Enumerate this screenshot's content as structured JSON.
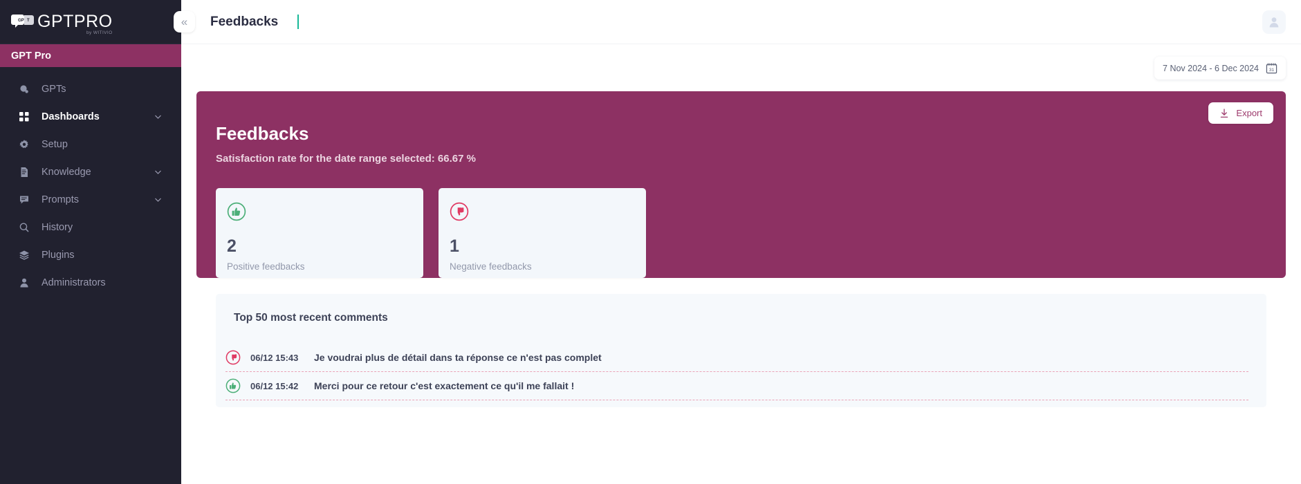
{
  "brand": {
    "logo_text": "GPTPRO",
    "logo_sub": "by WITIVIO",
    "workspace": "GPT Pro"
  },
  "sidebar": {
    "collapse_label": "«",
    "items": [
      {
        "label": "GPTs",
        "icon": "gpts-icon",
        "active": false,
        "chevron": false
      },
      {
        "label": "Dashboards",
        "icon": "dashboard-icon",
        "active": true,
        "chevron": true
      },
      {
        "label": "Setup",
        "icon": "gear-icon",
        "active": false,
        "chevron": false
      },
      {
        "label": "Knowledge",
        "icon": "document-icon",
        "active": false,
        "chevron": true
      },
      {
        "label": "Prompts",
        "icon": "chat-icon",
        "active": false,
        "chevron": true
      },
      {
        "label": "History",
        "icon": "search-clock-icon",
        "active": false,
        "chevron": false
      },
      {
        "label": "Plugins",
        "icon": "layers-icon",
        "active": false,
        "chevron": false
      },
      {
        "label": "Administrators",
        "icon": "person-icon",
        "active": false,
        "chevron": false
      }
    ]
  },
  "topbar": {
    "title": "Feedbacks",
    "avatar_icon": "avatar-icon"
  },
  "filters": {
    "date_range": "7 Nov 2024 - 6 Dec 2024",
    "calendar_icon": "calendar-icon",
    "calendar_day": "31"
  },
  "hero": {
    "title": "Feedbacks",
    "subtitle": "Satisfaction rate for the date range selected: 66.67 %",
    "export_label": "Export",
    "export_icon": "download-icon",
    "accent_color": "#8d3163"
  },
  "stats": [
    {
      "value": "2",
      "label": "Positive feedbacks",
      "icon": "thumbs-up-icon",
      "color": "#4caf78"
    },
    {
      "value": "1",
      "label": "Negative feedbacks",
      "icon": "thumbs-down-icon",
      "color": "#e03a63"
    }
  ],
  "comments_panel": {
    "title": "Top 50 most recent comments",
    "items": [
      {
        "sentiment": "negative",
        "icon": "thumbs-down-icon",
        "date": "06/12 15:43",
        "text": "Je voudrai plus de détail dans ta réponse ce n'est pas complet"
      },
      {
        "sentiment": "positive",
        "icon": "thumbs-up-icon",
        "date": "06/12 15:42",
        "text": "Merci pour ce retour c'est exactement ce qu'il me fallait !"
      }
    ]
  }
}
